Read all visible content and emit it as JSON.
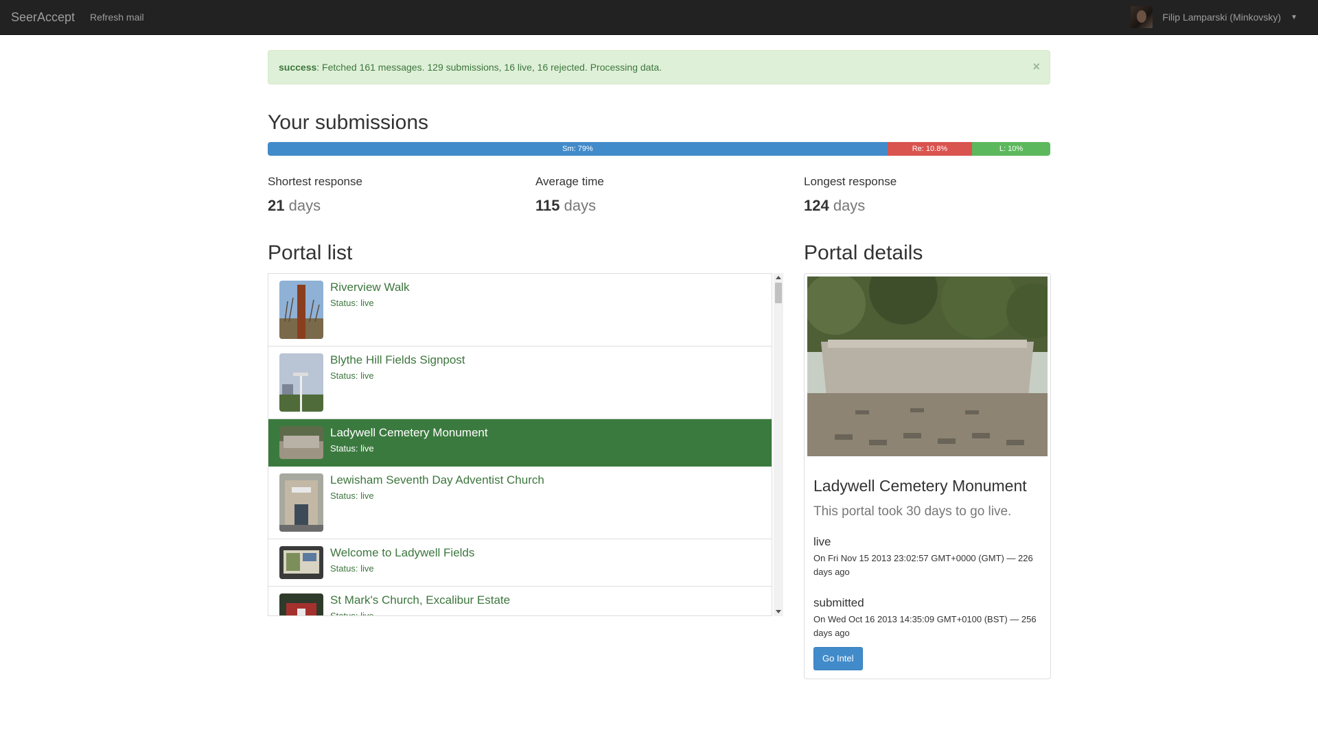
{
  "navbar": {
    "brand": "SeerAccept",
    "refresh_label": "Refresh mail",
    "user_name": "Filip Lamparski (Minkovsky)"
  },
  "alert": {
    "prefix": "success",
    "message": ": Fetched 161 messages. 129 submissions, 16 live, 16 rejected. Processing data.",
    "close": "×"
  },
  "submissions": {
    "heading": "Your submissions",
    "progress": {
      "sm_label": "Sm: 79%",
      "re_label": "Re: 10.8%",
      "l_label": "L: 10%",
      "sm_pct": 79.2,
      "re_pct": 10.8,
      "l_pct": 10,
      "colors": {
        "sm": "#428bca",
        "re": "#d9534f",
        "l": "#5cb85c"
      }
    },
    "stats": [
      {
        "label": "Shortest response",
        "value": "21",
        "unit": " days"
      },
      {
        "label": "Average time",
        "value": "115",
        "unit": " days"
      },
      {
        "label": "Longest response",
        "value": "124",
        "unit": " days"
      }
    ]
  },
  "portal_list": {
    "heading": "Portal list",
    "items": [
      {
        "title": "Riverview Walk",
        "status": "Status: live",
        "thumb": "signpost-photo"
      },
      {
        "title": "Blythe Hill Fields Signpost",
        "status": "Status: live",
        "thumb": "sky-signpost-photo"
      },
      {
        "title": "Ladywell Cemetery Monument",
        "status": "Status: live",
        "thumb": "monument-photo",
        "active": true
      },
      {
        "title": "Lewisham Seventh Day Adventist Church",
        "status": "Status: live",
        "thumb": "church-photo"
      },
      {
        "title": "Welcome to Ladywell Fields",
        "status": "Status: live",
        "thumb": "board-photo"
      },
      {
        "title": "St Mark's Church, Excalibur Estate",
        "status": "Status: live",
        "thumb": "church-red-photo"
      }
    ]
  },
  "portal_details": {
    "heading": "Portal details",
    "title": "Ladywell Cemetery Monument",
    "lead": "This portal took 30 days to go live.",
    "events": [
      {
        "name": "live",
        "text": "On Fri Nov 15 2013 23:02:57 GMT+0000 (GMT) — 226 days ago"
      },
      {
        "name": "submitted",
        "text": "On Wed Oct 16 2013 14:35:09 GMT+0100 (BST) — 256 days ago"
      }
    ],
    "button": "Go Intel"
  }
}
